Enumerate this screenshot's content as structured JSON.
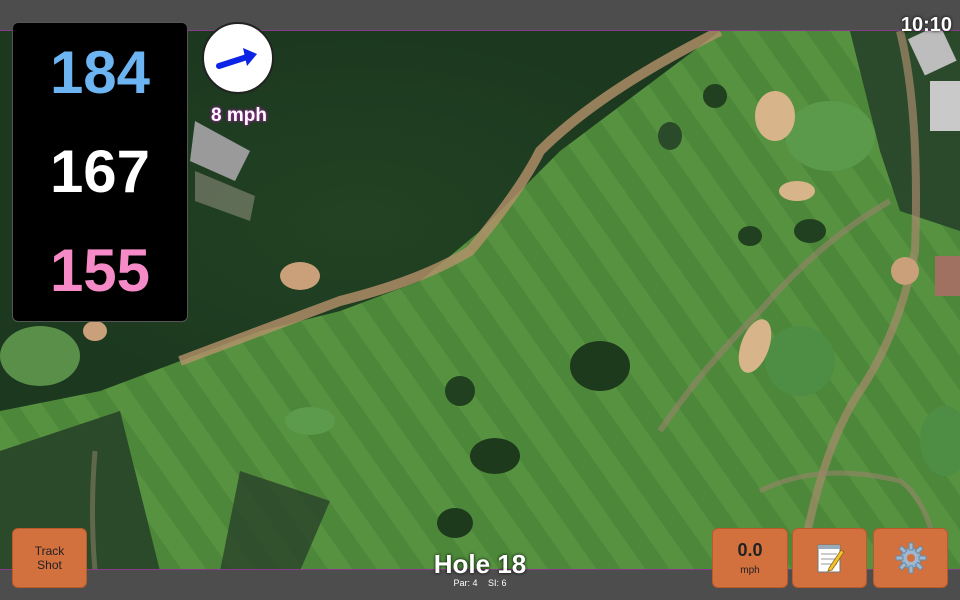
{
  "status": {
    "time": "10:10"
  },
  "yardages": {
    "back": "184",
    "center": "167",
    "front": "155"
  },
  "wind": {
    "speed_label": "8 mph",
    "direction_icon": "arrow-icon",
    "arrow_color": "#0b24e6"
  },
  "hole": {
    "title": "Hole 18",
    "par_label": "Par: 4",
    "si_label": "SI: 6"
  },
  "buttons": {
    "track_shot_line1": "Track",
    "track_shot_line2": "Shot",
    "speed_value": "0.0",
    "speed_unit": "mph",
    "notes_icon": "notepad-icon",
    "settings_icon": "gear-icon"
  },
  "colors": {
    "button_bg": "#d2703e",
    "back_yardage": "#6cb4f2",
    "front_yardage": "#f58ac6"
  }
}
